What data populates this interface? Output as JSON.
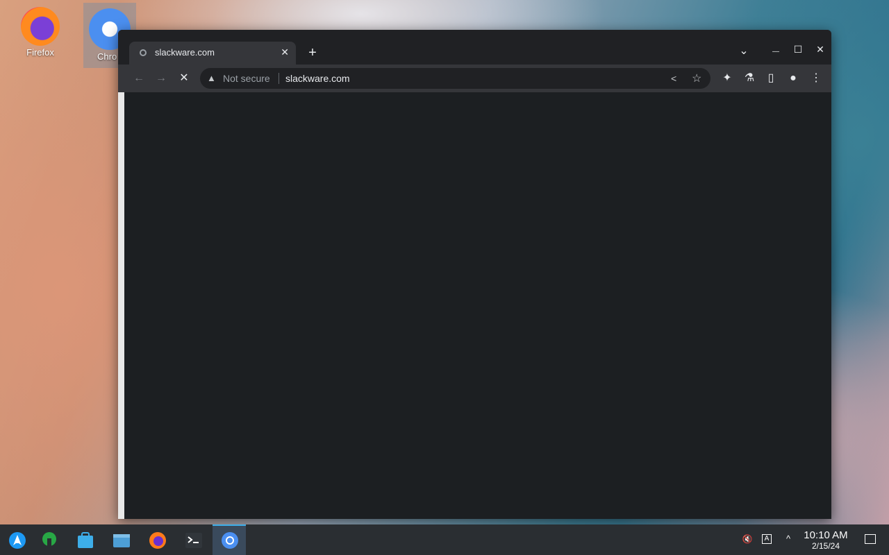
{
  "desktop": {
    "icons": [
      {
        "label": "Firefox"
      },
      {
        "label": "Chro"
      }
    ]
  },
  "browser": {
    "tab": {
      "title": "slackware.com",
      "close": "✕"
    },
    "newtab": "+",
    "controls": {
      "tabsearch": "⌄",
      "minimize": "—",
      "maximize": "☐",
      "close": "✕"
    },
    "toolbar": {
      "back": "←",
      "forward": "→",
      "stop": "✕",
      "security_label": "Not secure",
      "url": "slackware.com",
      "share": "<",
      "star": "☆",
      "extensions": "✦",
      "labs": "⚗",
      "sidepanel": "▯",
      "profile": "●",
      "menu": "⋮"
    }
  },
  "taskbar": {
    "clock_time": "10:10 AM",
    "clock_date": "2/15/24",
    "tray": {
      "volume": "🔇",
      "keyboard": "A",
      "expand": "^"
    }
  }
}
